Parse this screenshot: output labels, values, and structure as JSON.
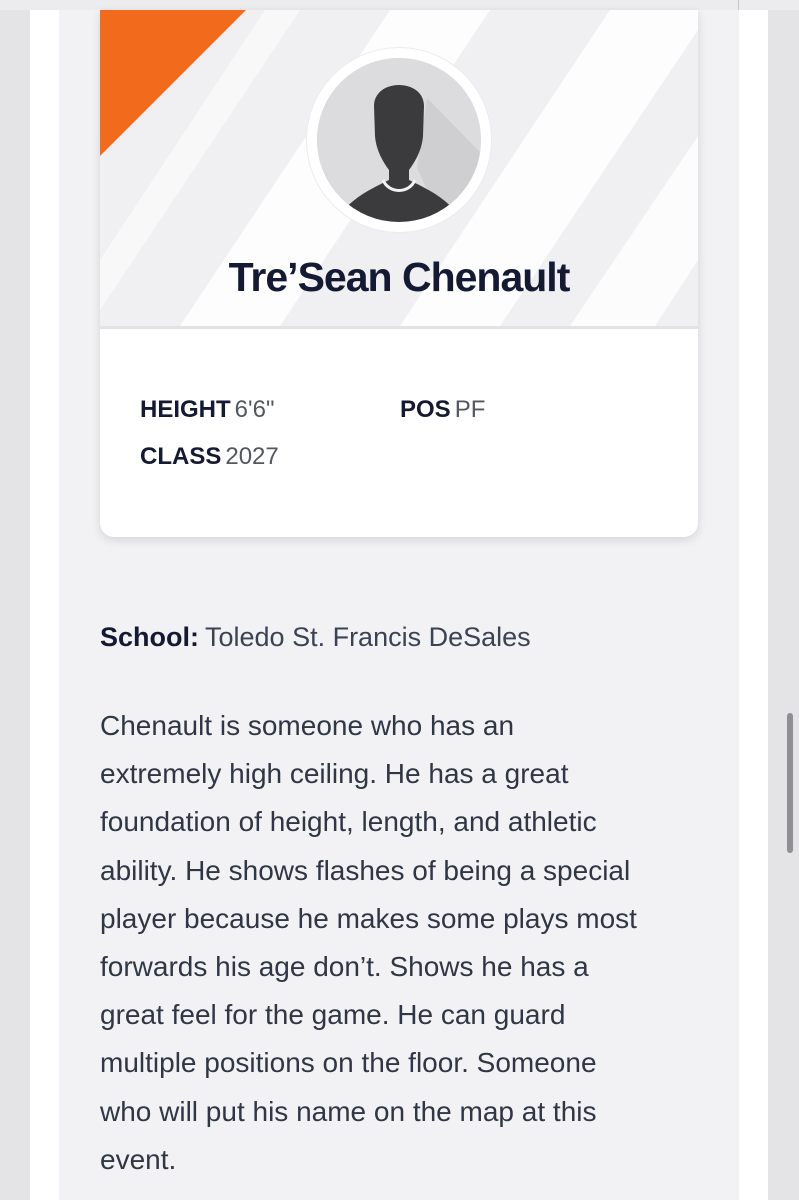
{
  "player": {
    "name": "Tre’Sean Chenault"
  },
  "stats": {
    "height": {
      "label": "HEIGHT",
      "value": "6'6\""
    },
    "pos": {
      "label": "POS",
      "value": "PF"
    },
    "class": {
      "label": "CLASS",
      "value": "2027"
    }
  },
  "school": {
    "label": "School:",
    "value": "Toledo St. Francis DeSales"
  },
  "bio": {
    "lines": [
      "Chenault is someone who has an",
      "extremely high ceiling. He has a great",
      "foundation of height, length, and athletic",
      "ability. He shows flashes of being a special",
      "player because he makes some plays most",
      "forwards his age don’t. Shows he has a",
      "great feel for the game. He can guard",
      "multiple positions on the floor. Someone",
      "who will put his name on the map at this",
      "event."
    ]
  },
  "icons": {
    "avatar": "player-silhouette-icon"
  },
  "colors": {
    "accent": "#f26b1d",
    "name_text": "#141a33",
    "body_text": "#2f3645",
    "page_background": "#f2f2f4"
  }
}
